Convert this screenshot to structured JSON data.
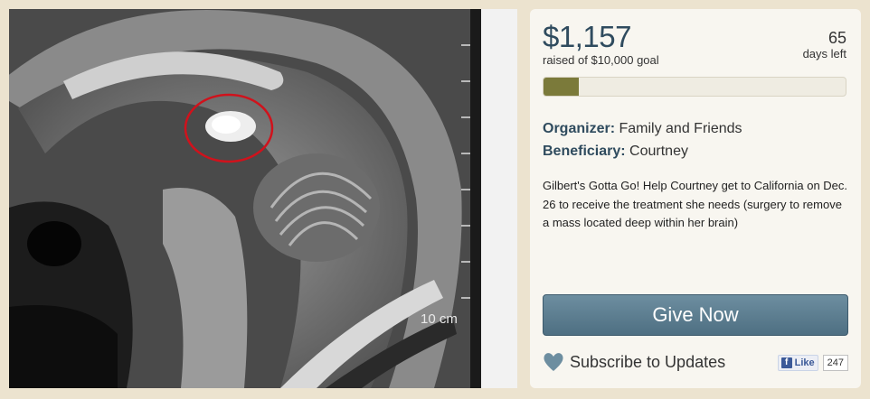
{
  "campaign": {
    "raised_amount": "$1,157",
    "raised_label": "raised of $10,000 goal",
    "days_left_number": "65",
    "days_left_label": "days left",
    "progress_fraction": 0.1157,
    "organizer_label": "Organizer:",
    "organizer_value": "Family and Friends",
    "beneficiary_label": "Beneficiary:",
    "beneficiary_value": "Courtney",
    "description": "Gilbert's Gotta Go! Help Courtney get to California on Dec. 26 to receive the treatment she needs (surgery to remove a mass located deep within her brain)"
  },
  "actions": {
    "give_now_label": "Give Now",
    "subscribe_label": "Subscribe to Updates",
    "subscribe_icon": "heart-icon",
    "fb_like_label": "Like",
    "fb_like_count": "247"
  },
  "photo": {
    "scale_label": "10 cm",
    "highlight_color": "#d0121c"
  },
  "colors": {
    "accent": "#2f4b5e",
    "progress_fill": "#7b7a3a",
    "button": "#5a7b8e",
    "page_bg": "#ece3cf"
  }
}
